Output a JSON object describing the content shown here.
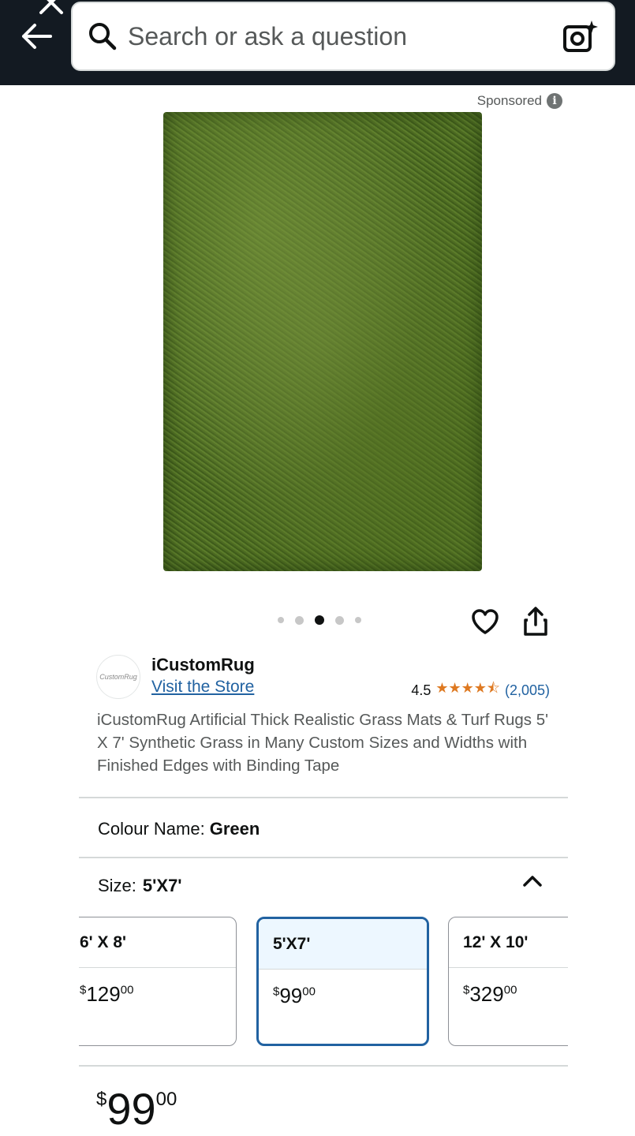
{
  "search": {
    "placeholder": "Search or ask a question"
  },
  "sponsored_label": "Sponsored",
  "gallery": {
    "image_count": 5,
    "active_index": 2
  },
  "brand": {
    "name": "iCustomRug",
    "logo_text": "CustomRug",
    "store_link": "Visit the Store"
  },
  "rating": {
    "value": "4.5",
    "stars": 4.5,
    "count": "(2,005)"
  },
  "product_title": "iCustomRug Artificial Thick Realistic Grass Mats & Turf Rugs 5' X 7' Synthetic Grass in Many Custom Sizes and Widths with Finished Edges with Binding Tape",
  "colour": {
    "label": "Colour Name:",
    "value": "Green"
  },
  "size": {
    "label": "Size:",
    "value": "5'X7'",
    "options": [
      {
        "label": "6' X 8'",
        "currency": "$",
        "whole": "129",
        "fraction": "00"
      },
      {
        "label": "5'X7'",
        "currency": "$",
        "whole": "99",
        "fraction": "00",
        "selected": true
      },
      {
        "label": "12' X 10'",
        "currency": "$",
        "whole": "329",
        "fraction": "00"
      }
    ]
  },
  "price": {
    "currency": "$",
    "whole": "99",
    "fraction": "00"
  },
  "colors": {
    "header": "#131a22",
    "link": "#2162a1",
    "star": "#de7921",
    "selected_border": "#2162a1"
  }
}
